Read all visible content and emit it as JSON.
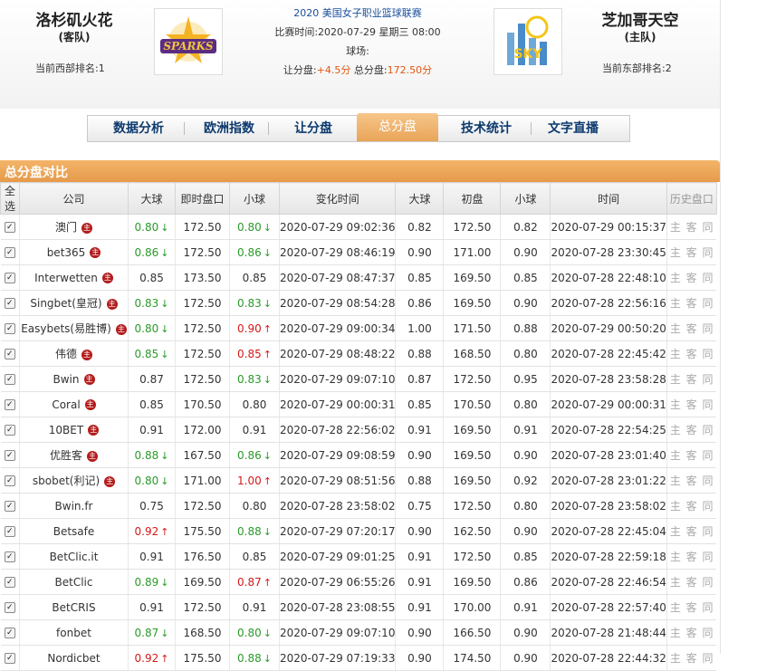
{
  "away": {
    "name": "洛杉矶火花",
    "role": "(客队)",
    "rank": "当前西部排名:1",
    "logo_text": "SPARKS"
  },
  "home": {
    "name": "芝加哥天空",
    "role": "(主队)",
    "rank": "当前东部排名:2",
    "logo_text": "SKY"
  },
  "match": {
    "league": "2020 美国女子职业篮球联赛",
    "time": "比赛时间:2020-07-29 星期三 08:00",
    "venue": "球场:",
    "handicap_label": "让分盘:",
    "handicap_value": "+4.5分",
    "total_label": "总分盘:",
    "total_value": "172.50分"
  },
  "tabs": [
    "数据分析",
    "欧洲指数",
    "让分盘",
    "总分盘",
    "技术统计",
    "文字直播"
  ],
  "active_tab": "总分盘",
  "section_title": "总分盘对比",
  "columns": [
    "全选",
    "公司",
    "大球",
    "即时盘口",
    "小球",
    "变化时间",
    "大球",
    "初盘",
    "小球",
    "时间",
    "历史盘口"
  ],
  "history_links": "主 客 同",
  "colors": {
    "accent": "#e69a4b",
    "up": "#d41919",
    "down": "#2a9a2a",
    "tab_text": "#0d3a6e"
  },
  "rows": [
    {
      "company": "澳门",
      "badge": true,
      "over": "0.80",
      "over_dir": "down",
      "line": "172.50",
      "under": "0.80",
      "under_dir": "down",
      "change": "2020-07-29 09:02:36",
      "o_over": "0.82",
      "o_line": "172.50",
      "o_under": "0.82",
      "time": "2020-07-29 00:15:37"
    },
    {
      "company": "bet365",
      "badge": true,
      "over": "0.86",
      "over_dir": "down",
      "line": "172.50",
      "under": "0.86",
      "under_dir": "down",
      "change": "2020-07-29 08:46:19",
      "o_over": "0.90",
      "o_line": "171.00",
      "o_under": "0.90",
      "time": "2020-07-28 23:30:45"
    },
    {
      "company": "Interwetten",
      "badge": true,
      "over": "0.85",
      "over_dir": "",
      "line": "173.50",
      "under": "0.85",
      "under_dir": "",
      "change": "2020-07-29 08:47:37",
      "o_over": "0.85",
      "o_line": "169.50",
      "o_under": "0.85",
      "time": "2020-07-28 22:48:10"
    },
    {
      "company": "Singbet(皇冠)",
      "badge": true,
      "over": "0.83",
      "over_dir": "down",
      "line": "172.50",
      "under": "0.83",
      "under_dir": "down",
      "change": "2020-07-29 08:54:28",
      "o_over": "0.86",
      "o_line": "169.50",
      "o_under": "0.90",
      "time": "2020-07-28 22:56:16"
    },
    {
      "company": "Easybets(易胜博)",
      "badge": true,
      "over": "0.80",
      "over_dir": "down",
      "line": "172.50",
      "under": "0.90",
      "under_dir": "up",
      "change": "2020-07-29 09:00:34",
      "o_over": "1.00",
      "o_line": "171.50",
      "o_under": "0.88",
      "time": "2020-07-29 00:50:20"
    },
    {
      "company": "伟德",
      "badge": true,
      "over": "0.85",
      "over_dir": "down",
      "line": "172.50",
      "under": "0.85",
      "under_dir": "up",
      "change": "2020-07-29 08:48:22",
      "o_over": "0.88",
      "o_line": "168.50",
      "o_under": "0.80",
      "time": "2020-07-28 22:45:42"
    },
    {
      "company": "Bwin",
      "badge": true,
      "over": "0.87",
      "over_dir": "",
      "line": "172.50",
      "under": "0.83",
      "under_dir": "down",
      "change": "2020-07-29 09:07:10",
      "o_over": "0.87",
      "o_line": "172.50",
      "o_under": "0.95",
      "time": "2020-07-28 23:58:28"
    },
    {
      "company": "Coral",
      "badge": true,
      "over": "0.85",
      "over_dir": "",
      "line": "170.50",
      "under": "0.80",
      "under_dir": "",
      "change": "2020-07-29 00:00:31",
      "o_over": "0.85",
      "o_line": "170.50",
      "o_under": "0.80",
      "time": "2020-07-29 00:00:31"
    },
    {
      "company": "10BET",
      "badge": true,
      "over": "0.91",
      "over_dir": "",
      "line": "172.00",
      "under": "0.91",
      "under_dir": "",
      "change": "2020-07-28 22:56:02",
      "o_over": "0.91",
      "o_line": "169.50",
      "o_under": "0.91",
      "time": "2020-07-28 22:54:25"
    },
    {
      "company": "优胜客",
      "badge": true,
      "over": "0.88",
      "over_dir": "down",
      "line": "167.50",
      "under": "0.86",
      "under_dir": "down",
      "change": "2020-07-29 09:08:59",
      "o_over": "0.90",
      "o_line": "169.50",
      "o_under": "0.90",
      "time": "2020-07-28 23:01:40"
    },
    {
      "company": "sbobet(利记)",
      "badge": true,
      "over": "0.80",
      "over_dir": "down",
      "line": "171.00",
      "under": "1.00",
      "under_dir": "up",
      "change": "2020-07-29 08:51:56",
      "o_over": "0.88",
      "o_line": "169.50",
      "o_under": "0.92",
      "time": "2020-07-28 23:01:22"
    },
    {
      "company": "Bwin.fr",
      "badge": false,
      "over": "0.75",
      "over_dir": "",
      "line": "172.50",
      "under": "0.80",
      "under_dir": "",
      "change": "2020-07-28 23:58:02",
      "o_over": "0.75",
      "o_line": "172.50",
      "o_under": "0.80",
      "time": "2020-07-28 23:58:02"
    },
    {
      "company": "Betsafe",
      "badge": false,
      "over": "0.92",
      "over_dir": "up",
      "line": "175.50",
      "under": "0.88",
      "under_dir": "down",
      "change": "2020-07-29 07:20:17",
      "o_over": "0.90",
      "o_line": "162.50",
      "o_under": "0.90",
      "time": "2020-07-28 22:45:04"
    },
    {
      "company": "BetClic.it",
      "badge": false,
      "over": "0.91",
      "over_dir": "",
      "line": "176.50",
      "under": "0.85",
      "under_dir": "",
      "change": "2020-07-29 09:01:25",
      "o_over": "0.91",
      "o_line": "172.50",
      "o_under": "0.85",
      "time": "2020-07-28 22:59:18"
    },
    {
      "company": "BetClic",
      "badge": false,
      "over": "0.89",
      "over_dir": "down",
      "line": "169.50",
      "under": "0.87",
      "under_dir": "up",
      "change": "2020-07-29 06:55:26",
      "o_over": "0.91",
      "o_line": "169.50",
      "o_under": "0.86",
      "time": "2020-07-28 22:46:54"
    },
    {
      "company": "BetCRIS",
      "badge": false,
      "over": "0.91",
      "over_dir": "",
      "line": "172.50",
      "under": "0.91",
      "under_dir": "",
      "change": "2020-07-28 23:08:55",
      "o_over": "0.91",
      "o_line": "170.00",
      "o_under": "0.91",
      "time": "2020-07-28 22:57:40"
    },
    {
      "company": "fonbet",
      "badge": false,
      "over": "0.87",
      "over_dir": "down",
      "line": "168.50",
      "under": "0.80",
      "under_dir": "down",
      "change": "2020-07-29 09:07:10",
      "o_over": "0.90",
      "o_line": "166.50",
      "o_under": "0.90",
      "time": "2020-07-28 21:48:44"
    },
    {
      "company": "Nordicbet",
      "badge": false,
      "over": "0.92",
      "over_dir": "up",
      "line": "175.50",
      "under": "0.88",
      "under_dir": "down",
      "change": "2020-07-29 07:19:33",
      "o_over": "0.90",
      "o_line": "174.50",
      "o_under": "0.90",
      "time": "2020-07-28 22:44:32"
    }
  ]
}
